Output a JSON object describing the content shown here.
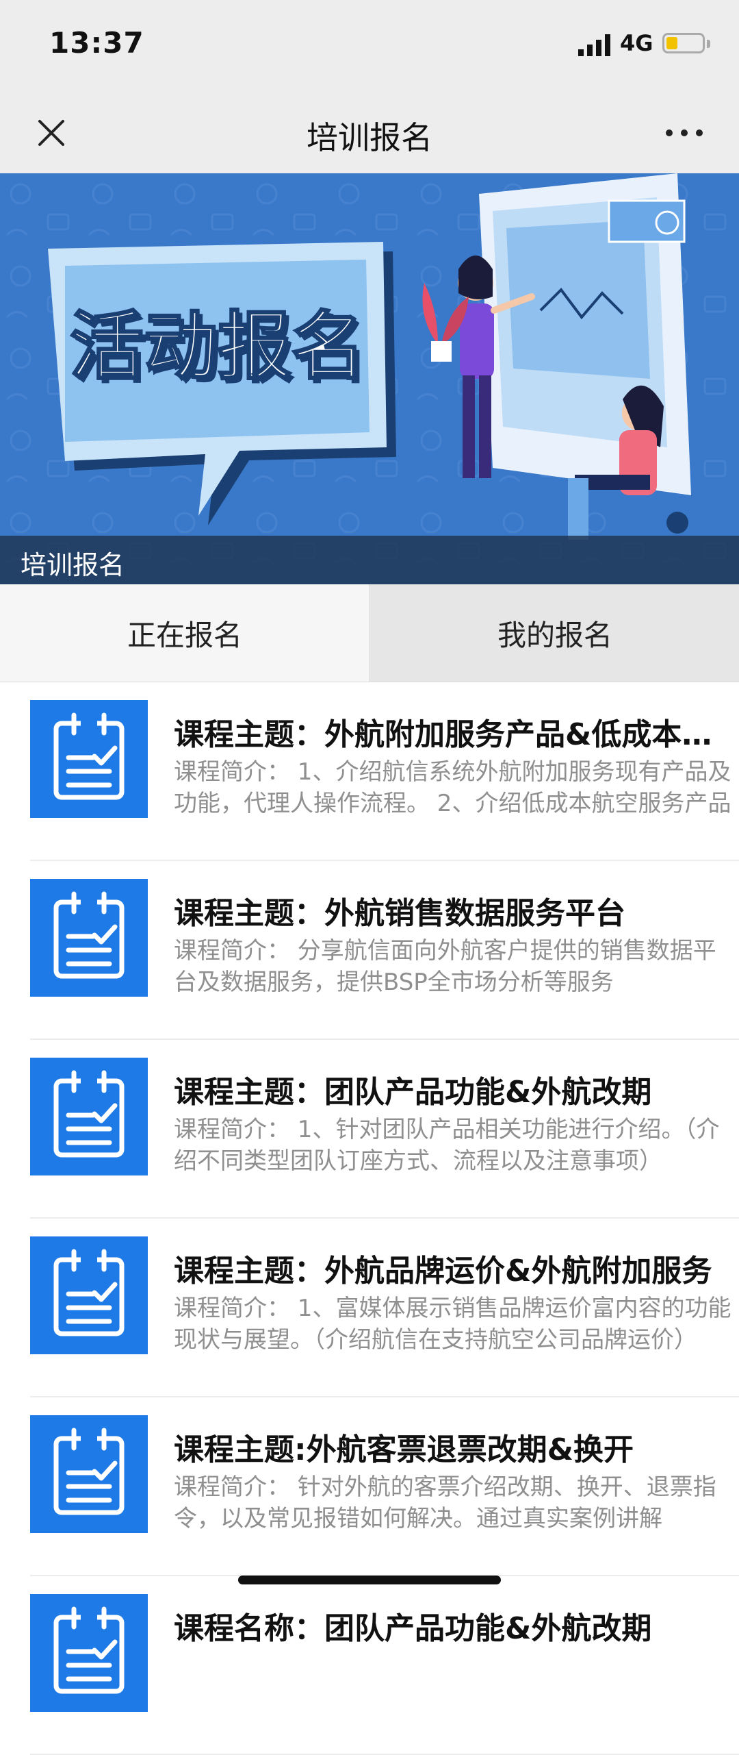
{
  "status_bar": {
    "time": "13:37",
    "network": "4G",
    "battery_level": 0.3,
    "battery_color": "#f2c200"
  },
  "nav": {
    "title": "培训报名"
  },
  "banner": {
    "headline": "活动报名",
    "caption": "培训报名"
  },
  "tabs": [
    {
      "label": "正在报名",
      "selected": true
    },
    {
      "label": "我的报名",
      "selected": false
    }
  ],
  "courses": [
    {
      "title": "课程主题：外航附加服务产品&低成本航空服务产品",
      "desc": "课程简介： 1、介绍航信系统外航附加服务现有产品及功能，代理人操作流程。 2、介绍低成本航空服务产品"
    },
    {
      "title": "课程主题：外航销售数据服务平台",
      "desc": "课程简介： 分享航信面向外航客户提供的销售数据平台及数据服务，提供BSP全市场分析等服务"
    },
    {
      "title": "课程主题：团队产品功能&外航改期",
      "desc": "课程简介： 1、针对团队产品相关功能进行介绍。（介绍不同类型团队订座方式、流程以及注意事项）"
    },
    {
      "title": "课程主题：外航品牌运价&外航附加服务",
      "desc": "课程简介： 1、富媒体展示销售品牌运价富内容的功能现状与展望。（介绍航信在支持航空公司品牌运价）"
    },
    {
      "title": "课程主题:外航客票退票改期&换开",
      "desc": "课程简介： 针对外航的客票介绍改期、换开、退票指令，以及常见报错如何解决。通过真实案例讲解"
    },
    {
      "title": "课程名称：团队产品功能&外航改期",
      "desc": ""
    }
  ],
  "colors": {
    "accent": "#1e7ae6",
    "banner": "#3a79c9"
  },
  "icons": [
    "close-icon",
    "more-icon",
    "course-calendar-icon"
  ]
}
